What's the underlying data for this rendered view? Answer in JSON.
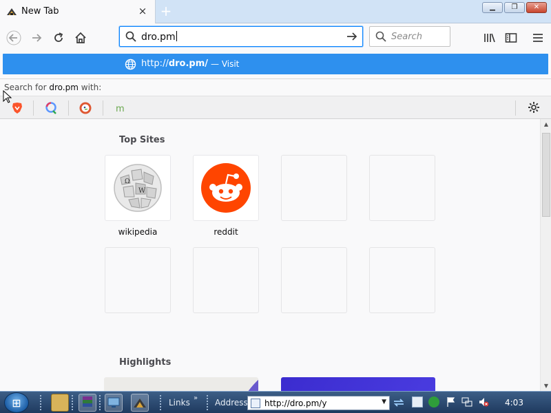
{
  "browser": {
    "tab": {
      "title": "New Tab",
      "close_glyph": "×",
      "favicon": "firefox-style-icon"
    },
    "new_tab_glyph": "+",
    "window_controls": {
      "minimize": "▁",
      "maximize": "❐",
      "close": "✕"
    }
  },
  "navbar": {
    "back_icon": "back-arrow-icon",
    "forward_icon": "forward-arrow-icon",
    "reload_icon": "reload-icon",
    "home_icon": "home-icon",
    "url_value": "dro.pm",
    "go_icon": "go-arrow-icon",
    "search_placeholder": "Search",
    "library_icon": "library-icon",
    "sidebar_icon": "sidebar-icon",
    "menu_icon": "hamburger-menu-icon"
  },
  "autocomplete": {
    "url_prefix": "http://",
    "url_bold": "dro.pm/",
    "visit_text": "— Visit",
    "search_for_prefix": "Search for",
    "search_term": "dro.pm",
    "search_for_suffix": "with:",
    "engines": [
      "brave-icon",
      "qwant-icon",
      "duckduckgo-icon",
      "mojeek-icon"
    ],
    "settings_icon": "gear-icon"
  },
  "newtab": {
    "top_sites_title": "Top Sites",
    "top_sites": [
      {
        "label": "wikipedia",
        "icon": "wikipedia-globe-icon"
      },
      {
        "label": "reddit",
        "icon": "reddit-alien-icon",
        "color": "#ff4500"
      }
    ],
    "empty_tiles": 6,
    "highlights_title": "Highlights"
  },
  "taskbar": {
    "links_label": "Links",
    "address_label": "Address",
    "address_value": "http://dro.pm/y",
    "clock": "4:03",
    "start_glyph": "⊞"
  },
  "colors": {
    "accent": "#0a84ff",
    "popup_highlight": "#2e90ee",
    "reddit": "#ff4500",
    "taskbar": "#2a4a72"
  }
}
